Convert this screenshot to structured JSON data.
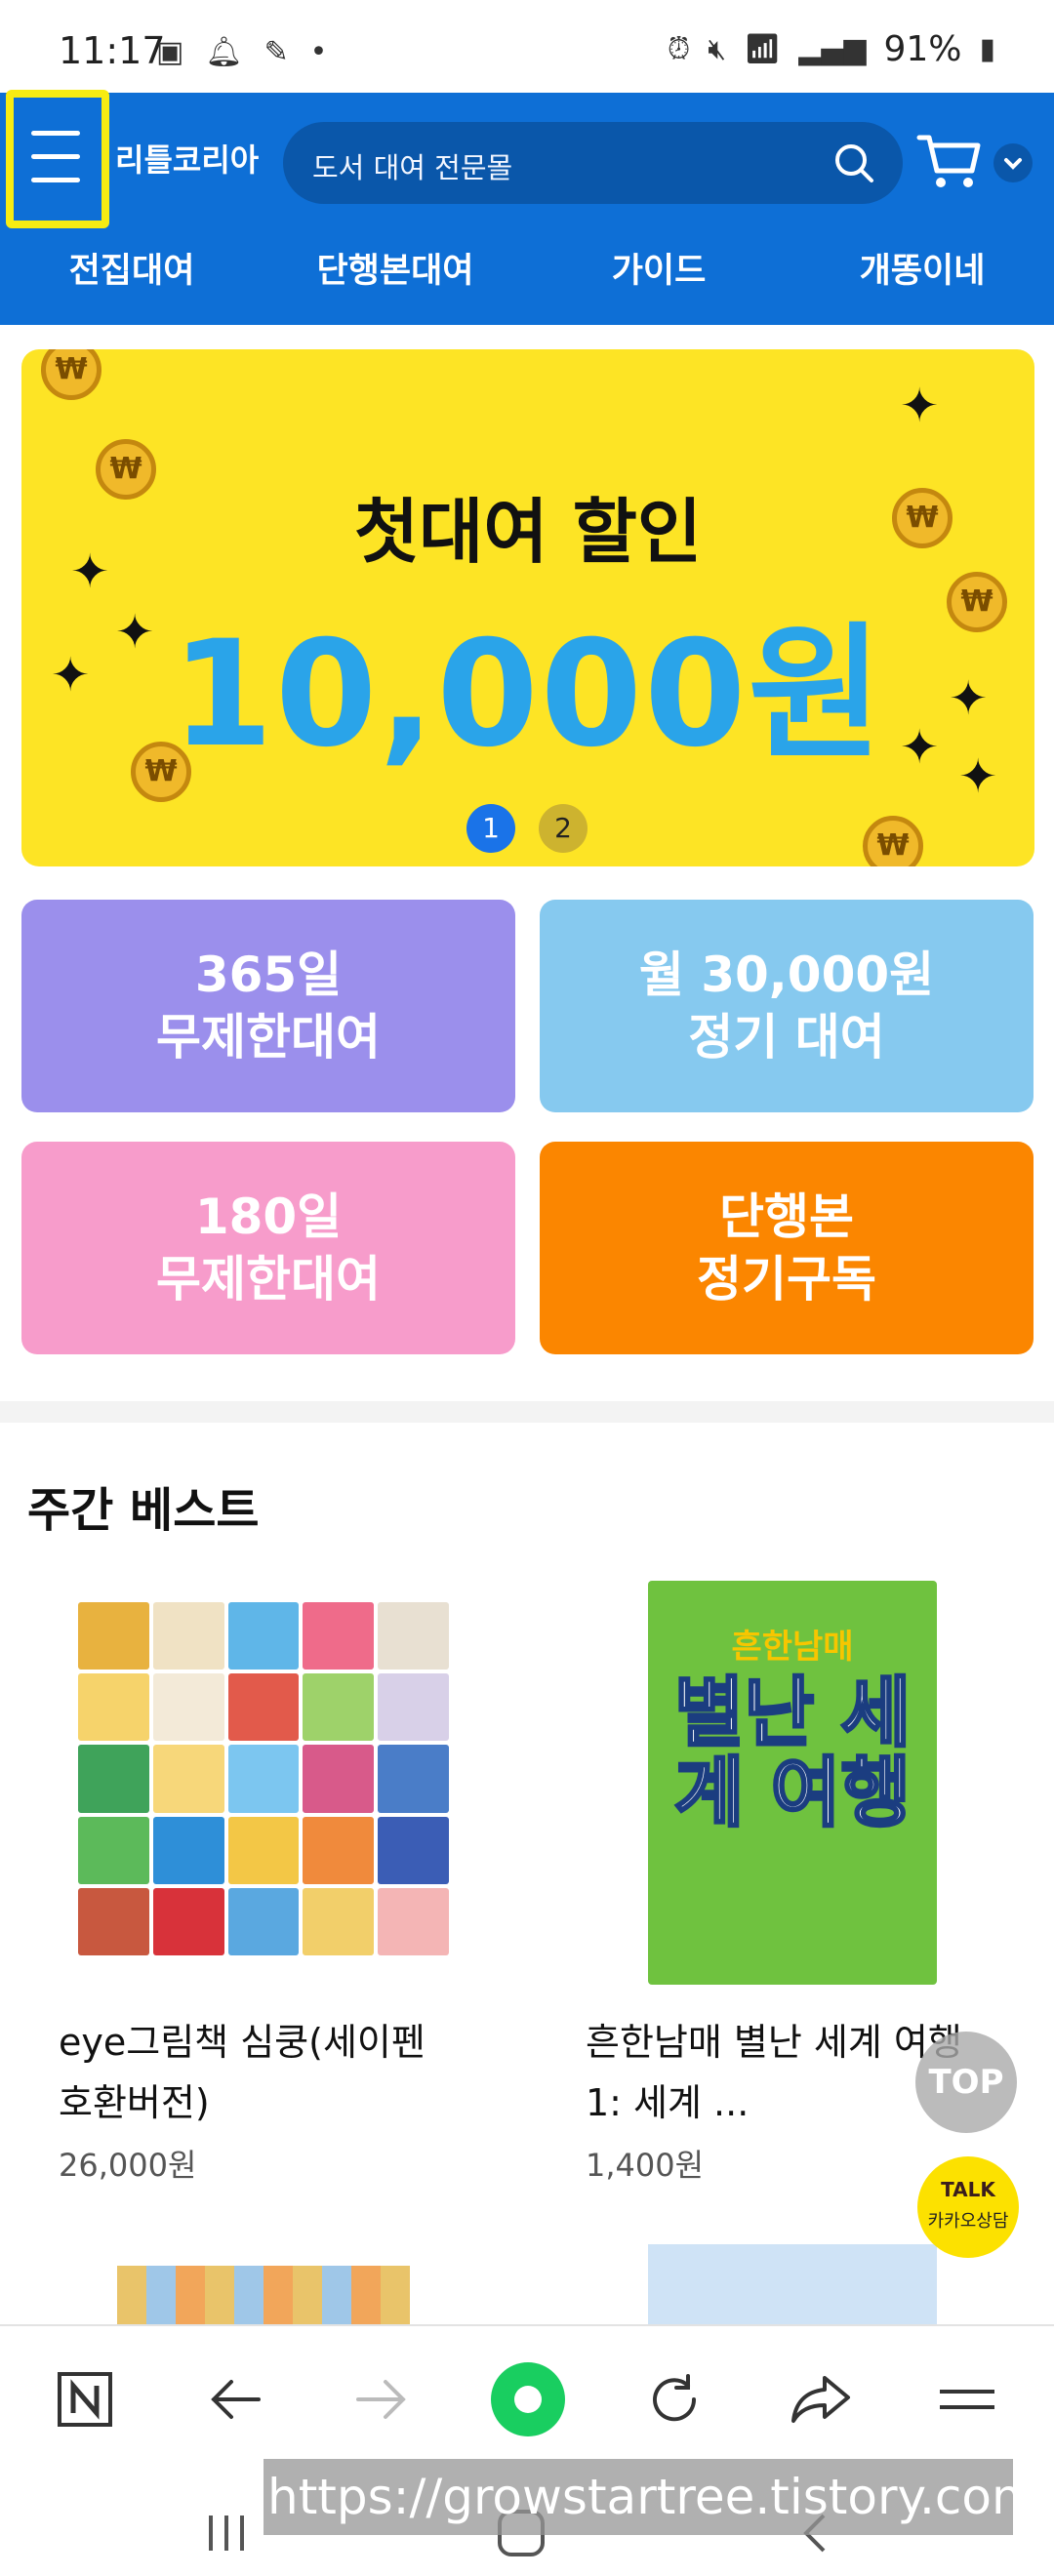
{
  "status_bar": {
    "time": "11:17",
    "battery": "91%",
    "dot": "•"
  },
  "header": {
    "logo_text": "리틀코리아",
    "search_placeholder": "도서 대여 전문몰",
    "nav": [
      "전집대여",
      "단행본대여",
      "가이드",
      "개똥이네"
    ]
  },
  "banner": {
    "title": "첫대여 할인",
    "amount": "10,000원",
    "page_dots": [
      "1",
      "2"
    ]
  },
  "tiles": [
    {
      "line1": "365일",
      "line2": "무제한대여",
      "color": "#9b8fec"
    },
    {
      "line1": "월 30,000원",
      "line2": "정기 대여",
      "color": "#86c9ef"
    },
    {
      "line1": "180일",
      "line2": "무제한대여",
      "color": "#f79ccb"
    },
    {
      "line1": "단행본",
      "line2": "정기구독",
      "color": "#fb8600"
    }
  ],
  "weekly_best": {
    "title": "주간 베스트",
    "books": [
      {
        "name_line1": "eye그림책 심쿵(세이펜",
        "name_line2": "호환버전)",
        "price": "26,000원"
      },
      {
        "name_line1": "흔한남매 별난 세계 여행",
        "name_line2": "1: 세계 ...",
        "price": "1,400원",
        "cover_brand": "흔한남매",
        "cover_title": "별난 세계 여행"
      }
    ]
  },
  "floating": {
    "top_label": "TOP",
    "talk_label": "TALK",
    "talk_sub": "카카오상담"
  },
  "watermark": "https://growstartree.tistory.com",
  "colors": {
    "brand_blue": "#0e6fd6",
    "banner_yellow": "#fde425",
    "accent_highlight": "#f7ec12"
  }
}
